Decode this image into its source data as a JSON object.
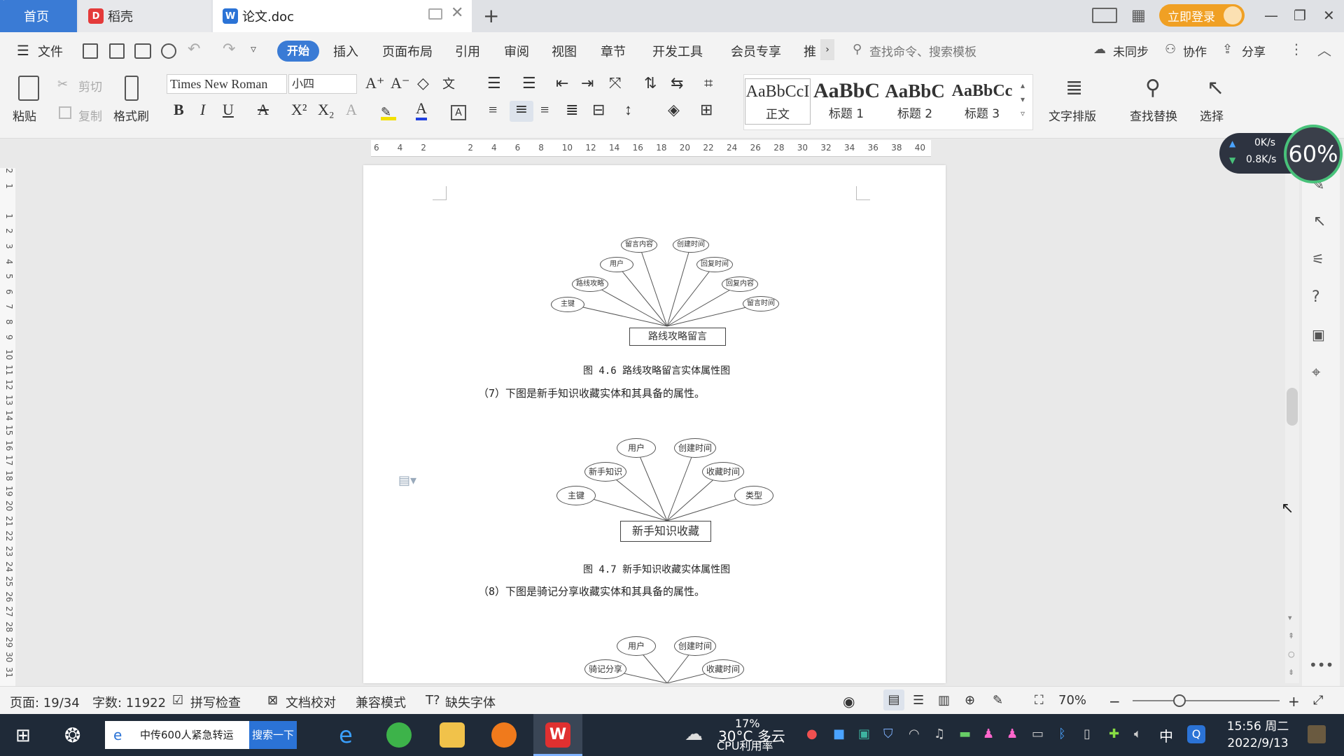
{
  "titlebar": {
    "tabs": [
      {
        "label": "首页"
      },
      {
        "label": "稻壳"
      },
      {
        "label": "论文.doc"
      }
    ],
    "login_label": "立即登录"
  },
  "menu": {
    "file": "文件",
    "items": [
      "开始",
      "插入",
      "页面布局",
      "引用",
      "审阅",
      "视图",
      "章节",
      "开发工具",
      "会员专享",
      "推"
    ],
    "search_placeholder": "查找命令、搜索模板",
    "unsynced": "未同步",
    "collab": "协作",
    "share": "分享"
  },
  "ribbon": {
    "paste": "粘贴",
    "cut": "剪切",
    "copy": "复制",
    "format_painter": "格式刷",
    "font_name": "Times New Roman",
    "font_size": "小四",
    "styles": [
      {
        "preview": "AaBbCcI",
        "name": "正文"
      },
      {
        "preview": "AaBbC",
        "name": "标题 1"
      },
      {
        "preview": "AaBbC",
        "name": "标题 2"
      },
      {
        "preview": "AaBbCc",
        "name": "标题 3"
      }
    ],
    "text_layout": "文字排版",
    "find_replace": "查找替换",
    "select": "选择"
  },
  "ruler": {
    "h_ticks": [
      "6",
      "4",
      "2",
      "",
      "2",
      "4",
      "6",
      "8",
      "10",
      "12",
      "14",
      "16",
      "18",
      "20",
      "22",
      "24",
      "26",
      "28",
      "30",
      "32",
      "34",
      "36",
      "38",
      "40"
    ],
    "v_ticks": [
      "2",
      "1",
      "",
      "1",
      "2",
      "3",
      "4",
      "5",
      "6",
      "7",
      "8",
      "9",
      "10",
      "11",
      "12",
      "13",
      "14",
      "15",
      "16",
      "17",
      "18",
      "19",
      "20",
      "21",
      "22",
      "23",
      "24",
      "25",
      "26",
      "27",
      "28",
      "29",
      "30",
      "31"
    ]
  },
  "widgets": {
    "net_up": "0K/s",
    "net_down": "0.8K/s",
    "cpu": "60%"
  },
  "document": {
    "diagram1": {
      "entity": "路线攻略留言",
      "attributes": [
        "主键",
        "路线攻略",
        "用户",
        "留言内容",
        "创建时间",
        "回复时间",
        "回复内容",
        "留言时间"
      ],
      "caption": "图 4.6 路线攻略留言实体属性图"
    },
    "para7": "（7）下图是新手知识收藏实体和其具备的属性。",
    "diagram2": {
      "entity": "新手知识收藏",
      "attributes": [
        "主键",
        "新手知识",
        "用户",
        "创建时间",
        "收藏时间",
        "类型"
      ],
      "caption": "图 4.7 新手知识收藏实体属性图"
    },
    "para8": "（8）下图是骑记分享收藏实体和其具备的属性。",
    "diagram3": {
      "attributes": [
        "骑记分享",
        "用户",
        "创建时间",
        "收藏时间"
      ]
    }
  },
  "statusbar": {
    "page": "页面: 19/34",
    "words": "字数: 11922",
    "spell": "拼写检查",
    "proof": "文档校对",
    "compat": "兼容模式",
    "missing_font": "缺失字体",
    "zoom": "70%"
  },
  "taskbar": {
    "search_text": "中传600人紧急转运",
    "search_btn": "搜索一下",
    "weather": "30°C 多云",
    "cpu_usage": "17%",
    "cpu_label": "CPU利用率",
    "ime": "中",
    "time": "15:56 周二",
    "date": "2022/9/13"
  }
}
